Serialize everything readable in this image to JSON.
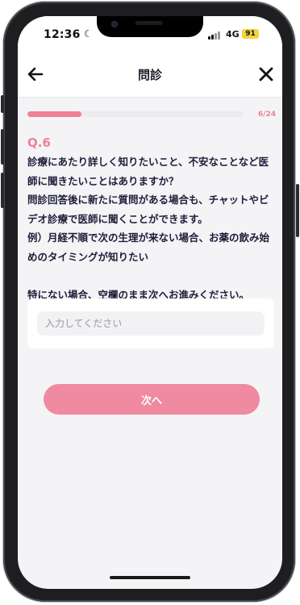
{
  "status_bar": {
    "time": "12:36",
    "network": "4G",
    "battery": "91",
    "moon_icon": "moon-icon"
  },
  "header": {
    "title": "問診",
    "back_icon": "arrow-left-icon",
    "close_icon": "close-icon"
  },
  "progress": {
    "text": "6/24",
    "current": 6,
    "total": 24,
    "fill_fraction": 0.25,
    "color": "#ef8095"
  },
  "question": {
    "number": "Q.6",
    "lines": [
      "診療にあたり詳しく知りたいこと、不安なことなど医",
      "師に聞きたいことはありますか？",
      "問診回答後に新たに質問がある場合も、チャットやビ",
      "デオ診療で医師に聞くことができます。",
      "例）月経不順で次の生理が来ない場合、お薬の飲み始",
      "めのタイミングが知りたい",
      "",
      "特にない場合、空欄のまま次へお進みください。"
    ]
  },
  "answer": {
    "value": "",
    "placeholder": "入力してください"
  },
  "next_button": {
    "label": "次へ",
    "color": "#f08aa0"
  },
  "colors": {
    "accent": "#ef8095",
    "text": "#1d1d3a",
    "background": "#f4f4f6"
  }
}
